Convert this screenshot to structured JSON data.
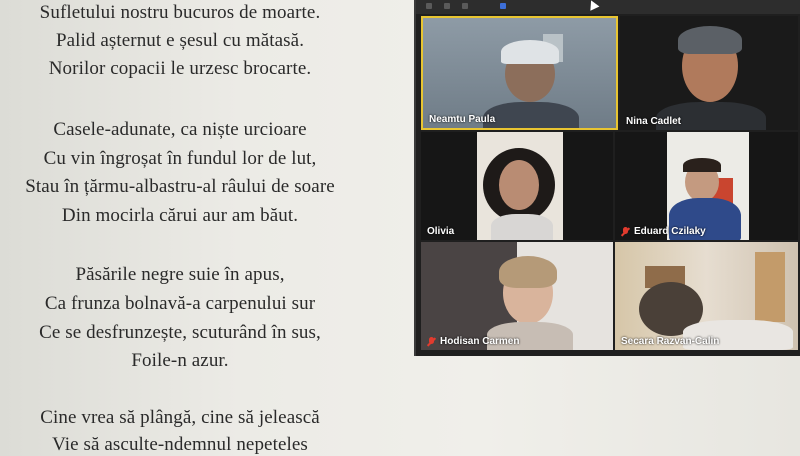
{
  "poem": {
    "lines": [
      "Sufletului nostru bucuros de moarte.",
      "Palid așternut e șesul cu mătasă.",
      "Norilor copacii le urzesc brocarte.",
      "",
      "Casele-adunate, ca niște urcioare",
      "Cu vin îngroșat în fundul lor de lut,",
      "Stau în țărmu-albastru-al râului de soare",
      "Din mocirla cărui aur am băut.",
      "",
      "Păsările negre suie în apus,",
      "Ca frunza bolnavă-a carpenului sur",
      "Ce se desfrunzește, scuturând în sus,",
      "Foile-n azur.",
      "",
      "Cine vrea să plângă, cine să jelească",
      "Vie să asculte-ndemnul nepeteles"
    ]
  },
  "meeting": {
    "participants": [
      {
        "name": "Neamtu Paula",
        "muted": false,
        "active_speaker": true
      },
      {
        "name": "Nina Cadlet",
        "muted": false,
        "active_speaker": false
      },
      {
        "name": "Olivia",
        "muted": false,
        "active_speaker": false
      },
      {
        "name": "Eduard Czilaky",
        "muted": true,
        "active_speaker": false
      },
      {
        "name": "Hodisan Carmen",
        "muted": true,
        "active_speaker": false
      },
      {
        "name": "Secara Razvan-Calin",
        "muted": false,
        "active_speaker": false
      }
    ],
    "active_speaker_color": "#e8c531",
    "muted_icon_color": "#e23b2e"
  }
}
